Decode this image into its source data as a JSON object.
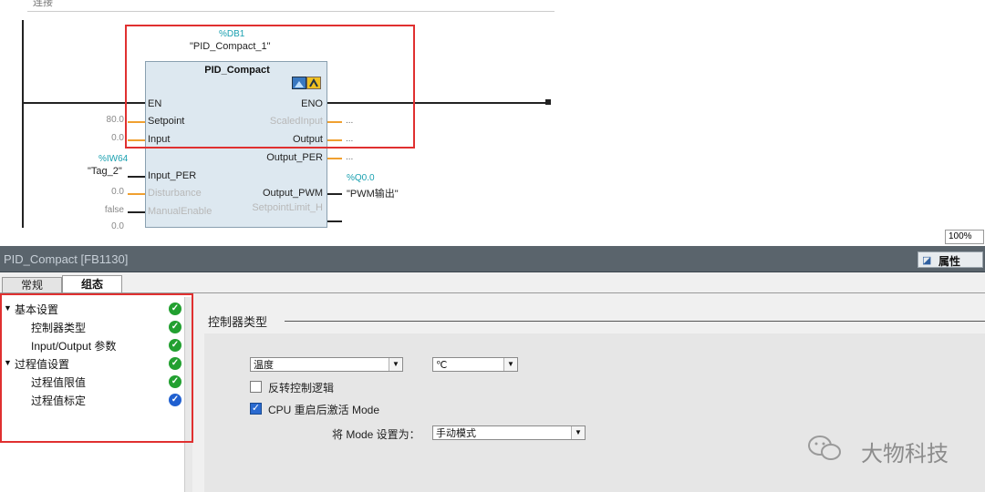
{
  "top_label": "连接",
  "zoom": "100%",
  "ladder": {
    "db_ref": "%DB1",
    "instance_name": "\"PID_Compact_1\"",
    "block_title": "PID_Compact",
    "pins_left": [
      {
        "name": "EN",
        "value": "",
        "enabled": true
      },
      {
        "name": "Setpoint",
        "value": "80.0",
        "enabled": true
      },
      {
        "name": "Input",
        "value": "0.0",
        "enabled": true
      },
      {
        "name": "Input_PER",
        "value": "",
        "enabled": true
      },
      {
        "name": "Disturbance",
        "value": "0.0",
        "enabled": false
      },
      {
        "name": "ManualEnable",
        "value": "false",
        "enabled": false
      }
    ],
    "pins_right": [
      {
        "name": "ENO",
        "value": "",
        "enabled": true
      },
      {
        "name": "ScaledInput",
        "value": "...",
        "enabled": false
      },
      {
        "name": "Output",
        "value": "...",
        "enabled": true
      },
      {
        "name": "Output_PER",
        "value": "...",
        "enabled": true
      },
      {
        "name": "Output_PWM",
        "value": "",
        "enabled": true
      },
      {
        "name": "SetpointLimit_H",
        "value": "",
        "enabled": false
      }
    ],
    "iw_ref": "%IW64",
    "iw_tag": "\"Tag_2\"",
    "q_ref": "%Q0.0",
    "q_tag": "\"PWM输出\"",
    "partial_value": "0.0"
  },
  "inspector": {
    "title": "PID_Compact [FB1130]",
    "properties_label": "属性",
    "tabs": [
      "常规",
      "组态"
    ],
    "active_tab": 1,
    "tree": [
      {
        "label": "基本设置",
        "level": 0,
        "status": "ok"
      },
      {
        "label": "控制器类型",
        "level": 1,
        "status": "ok"
      },
      {
        "label": "Input/Output 参数",
        "level": 1,
        "status": "ok"
      },
      {
        "label": "过程值设置",
        "level": 0,
        "status": "ok"
      },
      {
        "label": "过程值限值",
        "level": 1,
        "status": "ok"
      },
      {
        "label": "过程值标定",
        "level": 1,
        "status": "info"
      }
    ],
    "section_title": "控制器类型",
    "controller_type": "温度",
    "unit": "℃",
    "invert_label": "反转控制逻辑",
    "invert_checked": false,
    "restart_label": "CPU 重启后激活 Mode",
    "restart_checked": true,
    "mode_label": "将 Mode 设置为：",
    "mode_value": "手动模式"
  },
  "watermark": "大物科技",
  "colors": {
    "highlight": "#e03030",
    "ok": "#22a030",
    "info": "#2060d0",
    "block_bg": "#dde8f0"
  }
}
